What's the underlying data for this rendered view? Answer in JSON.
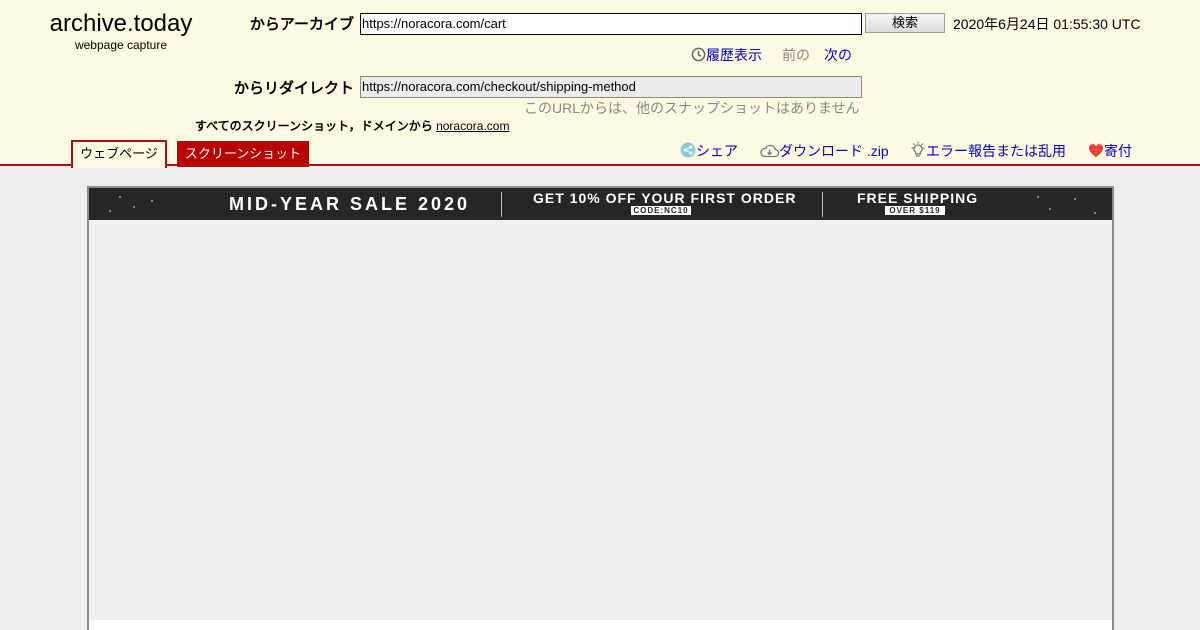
{
  "logo": {
    "name": "archive.today",
    "subtitle": "webpage capture"
  },
  "archive_row": {
    "label": "からアーカイブ",
    "url": "https://noracora.com/cart",
    "search_label": "検索",
    "date": "2020年6月24日 01:55:30 UTC"
  },
  "history_nav": {
    "history_label": "履歴表示",
    "prev_label": "前の",
    "next_label": "次の"
  },
  "redirect_row": {
    "label": "からリダイレクト",
    "url": "https://noracora.com/checkout/shipping-method",
    "no_snapshot_text": "このURLからは、他のスナップショットはありません"
  },
  "all_screenshots": {
    "text": "すべてのスクリーンショット，ドメインから",
    "domain_link": "noracora.com"
  },
  "tabs": [
    {
      "label": "ウェブページ",
      "active": true
    },
    {
      "label": "スクリーンショット",
      "active": false
    }
  ],
  "actions": {
    "share": "シェア",
    "download": "ダウンロード .zip",
    "report": "エラー報告または乱用",
    "donate": "寄付"
  },
  "banner": {
    "sale": "MID-YEAR SALE 2020",
    "offer": "GET 10% OFF YOUR FIRST ORDER",
    "code": "CODE:NC10",
    "shipping": "FREE SHIPPING",
    "shipping_min": "OVER $119"
  },
  "colors": {
    "header_bg": "#fffae1",
    "accent_red": "#a80e0e",
    "link_blue": "#0000cc"
  },
  "icons": [
    "clock-icon",
    "share-icon",
    "cloud-download-icon",
    "bulb-icon",
    "heart-icon"
  ]
}
